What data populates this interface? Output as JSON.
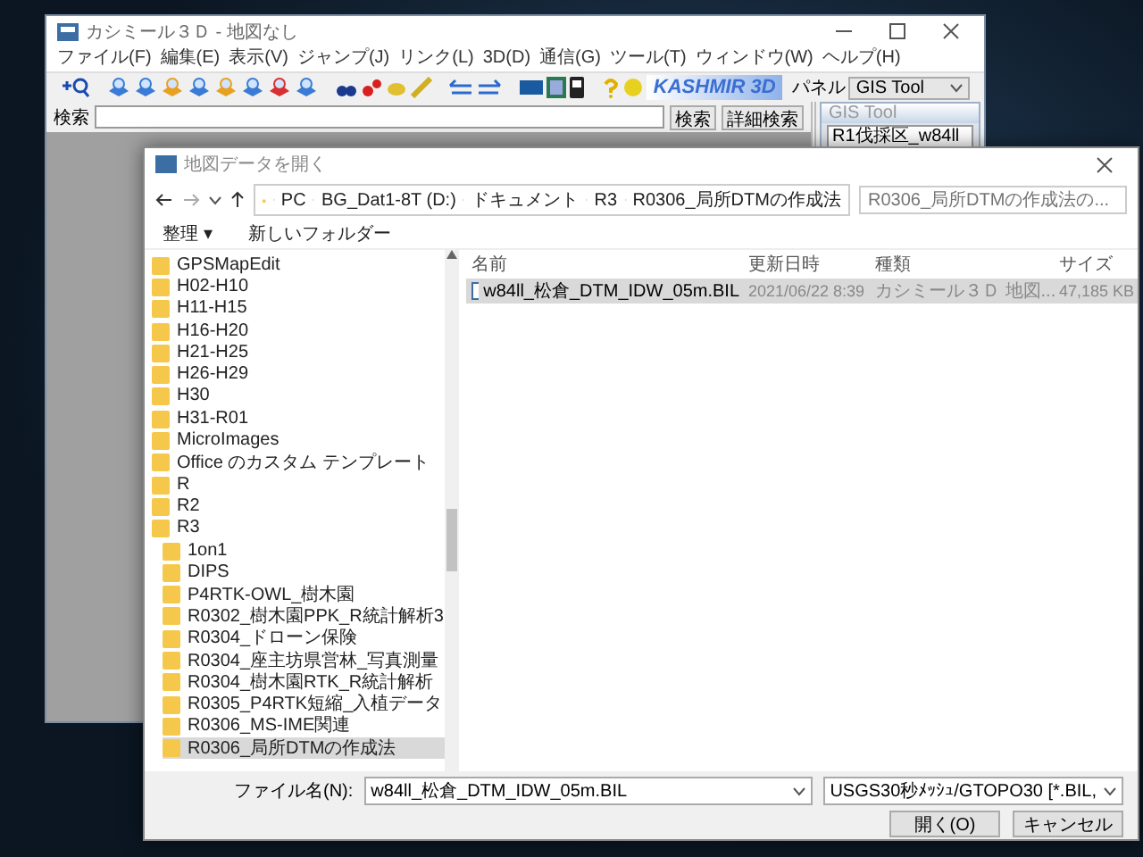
{
  "main_window": {
    "title": "カシミール３Ｄ - 地図なし",
    "menu": [
      "ファイル(F)",
      "編集(E)",
      "表示(V)",
      "ジャンプ(J)",
      "リンク(L)",
      "3D(D)",
      "通信(G)",
      "ツール(T)",
      "ウィンドウ(W)",
      "ヘルプ(H)"
    ],
    "logo": "KASHMIR 3D",
    "panel_label": "パネル",
    "panel_select": "GIS Tool",
    "search_label": "検索",
    "search_button": "検索",
    "advanced_search_button": "詳細検索",
    "gis_panel": {
      "title": "GIS Tool",
      "items": [
        "R1伐採区_w84ll"
      ]
    }
  },
  "dialog": {
    "title": "地図データを開く",
    "breadcrumbs": [
      "PC",
      "BG_Dat1-8T (D:)",
      "ドキュメント",
      "R3",
      "R0306_局所DTMの作成法"
    ],
    "search_placeholder": "R0306_局所DTMの作成法の...",
    "toolbar": [
      "整理 ▾",
      "新しいフォルダー"
    ],
    "tree": [
      {
        "label": "GPSMapEdit",
        "selected": false
      },
      {
        "label": "H02-H10",
        "selected": false
      },
      {
        "label": "H11-H15",
        "selected": false
      },
      {
        "label": "H16-H20",
        "selected": false
      },
      {
        "label": "H21-H25",
        "selected": false
      },
      {
        "label": "H26-H29",
        "selected": false
      },
      {
        "label": "H30",
        "selected": false
      },
      {
        "label": "H31-R01",
        "selected": false
      },
      {
        "label": "MicroImages",
        "selected": false
      },
      {
        "label": "Office のカスタム テンプレート",
        "selected": false
      },
      {
        "label": "R",
        "selected": false
      },
      {
        "label": "R2",
        "selected": false
      },
      {
        "label": "R3",
        "selected": false,
        "children": [
          {
            "label": "1on1",
            "selected": false
          },
          {
            "label": "DIPS",
            "selected": false
          },
          {
            "label": "P4RTK-OWL_樹木園",
            "selected": false
          },
          {
            "label": "R0302_樹木園PPK_R統計解析3",
            "selected": false
          },
          {
            "label": "R0304_ドローン保険",
            "selected": false
          },
          {
            "label": "R0304_座主坊県営林_写真測量",
            "selected": false
          },
          {
            "label": "R0304_樹木園RTK_R統計解析",
            "selected": false
          },
          {
            "label": "R0305_P4RTK短縮_入植データ",
            "selected": false
          },
          {
            "label": "R0306_MS-IME関連",
            "selected": false
          },
          {
            "label": "R0306_局所DTMの作成法",
            "selected": true
          }
        ]
      }
    ],
    "columns": [
      "名前",
      "更新日時",
      "種類",
      "サイズ"
    ],
    "files": [
      {
        "name": "w84ll_松倉_DTM_IDW_05m.BIL",
        "modified": "2021/06/22 8:39",
        "type": "カシミール３Ｄ 地図...",
        "size": "47,185 KB",
        "selected": true
      }
    ],
    "filename_label": "ファイル名(N):",
    "filename": "w84ll_松倉_DTM_IDW_05m.BIL",
    "filetype": "USGS30秒ﾒｯｼｭ/GTOPO30 [*.BIL,",
    "buttons": [
      "開く(O)",
      "キャンセル"
    ]
  }
}
